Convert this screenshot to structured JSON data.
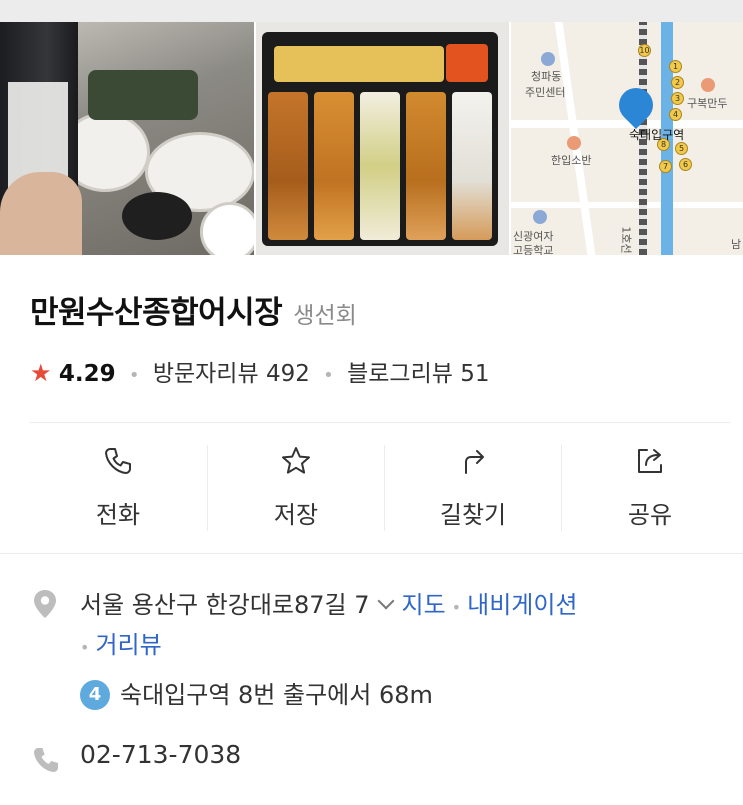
{
  "photos": {
    "map": {
      "labels": [
        "청파동",
        "주민센터",
        "구복만두",
        "숙대입구역",
        "한입소반",
        "신광여자",
        "고등학교",
        "1호선",
        "남"
      ],
      "stations": [
        "10",
        "1",
        "2",
        "3",
        "4",
        "8",
        "5",
        "6",
        "7"
      ]
    }
  },
  "place": {
    "name": "만원수산종합어시장",
    "category": "생선회",
    "rating": "4.29",
    "visitor_reviews": "방문자리뷰 492",
    "blog_reviews": "블로그리뷰 51"
  },
  "actions": [
    {
      "label": "전화",
      "icon": "phone-icon"
    },
    {
      "label": "저장",
      "icon": "star-icon"
    },
    {
      "label": "길찾기",
      "icon": "directions-icon"
    },
    {
      "label": "공유",
      "icon": "share-icon"
    }
  ],
  "address": {
    "text": "서울 용산구 한강대로87길 7",
    "map_link": "지도",
    "navigation_link": "내비게이션",
    "street_view_link": "거리뷰",
    "subway_line": "4",
    "subway_text": "숙대입구역 8번 출구에서 68m"
  },
  "phone": {
    "number": "02-713-7038"
  },
  "colors": {
    "link": "#2f66c8",
    "star": "#e84a3a",
    "subway_badge": "#5ea9dd"
  }
}
